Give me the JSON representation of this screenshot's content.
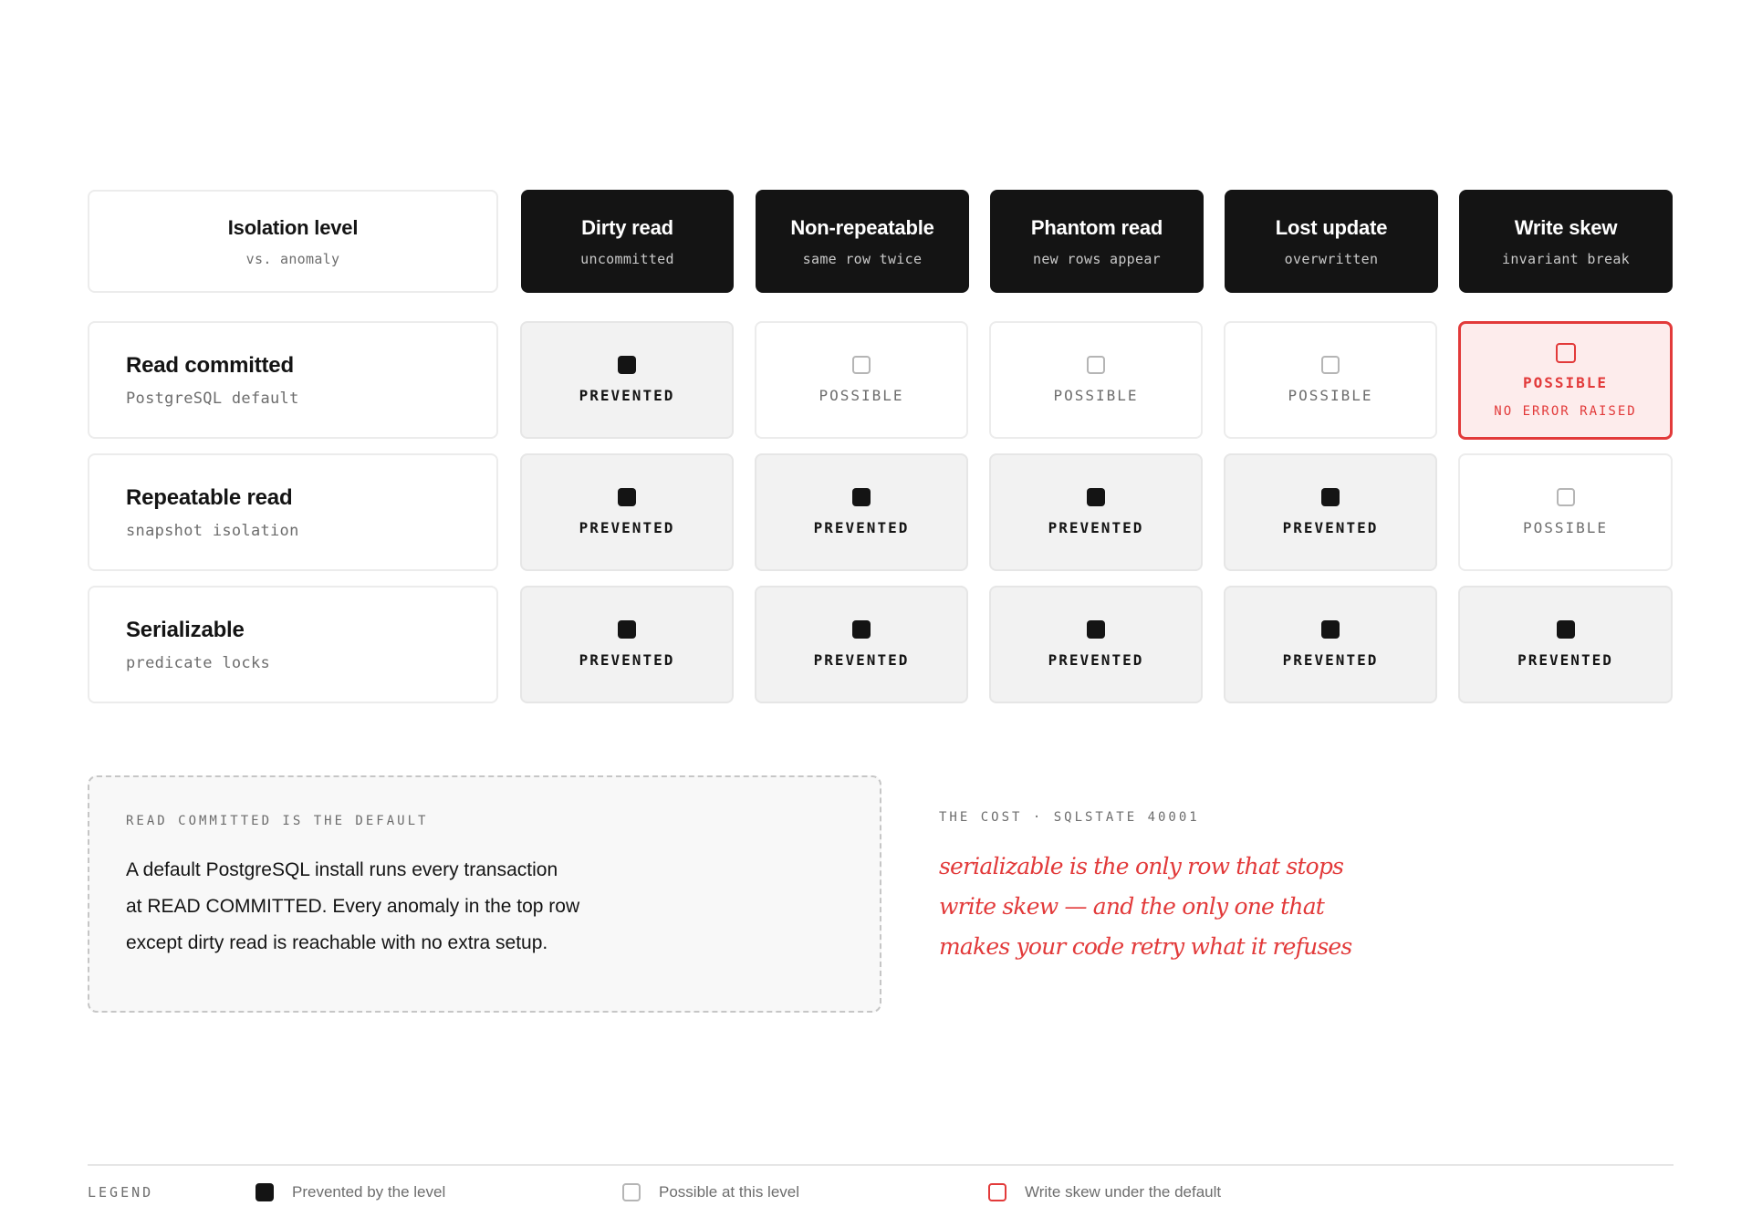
{
  "corner": {
    "title": "Isolation level",
    "subtitle": "vs. anomaly"
  },
  "columns": [
    {
      "title": "Dirty read",
      "subtitle": "uncommitted"
    },
    {
      "title": "Non-repeatable",
      "subtitle": "same row twice"
    },
    {
      "title": "Phantom read",
      "subtitle": "new rows appear"
    },
    {
      "title": "Lost update",
      "subtitle": "overwritten"
    },
    {
      "title": "Write skew",
      "subtitle": "invariant break"
    }
  ],
  "rows": [
    {
      "title": "Read committed",
      "subtitle": "PostgreSQL default",
      "cells": [
        {
          "status": "prevented",
          "label": "PREVENTED",
          "icon": "filled-square-icon"
        },
        {
          "status": "possible",
          "label": "POSSIBLE",
          "icon": "empty-square-icon"
        },
        {
          "status": "possible",
          "label": "POSSIBLE",
          "icon": "empty-square-icon"
        },
        {
          "status": "possible",
          "label": "POSSIBLE",
          "icon": "empty-square-icon"
        },
        {
          "status": "alert",
          "label": "POSSIBLE",
          "note": "NO ERROR RAISED",
          "icon": "red-square-icon"
        }
      ]
    },
    {
      "title": "Repeatable read",
      "subtitle": "snapshot isolation",
      "cells": [
        {
          "status": "prevented",
          "label": "PREVENTED",
          "icon": "filled-square-icon"
        },
        {
          "status": "prevented",
          "label": "PREVENTED",
          "icon": "filled-square-icon"
        },
        {
          "status": "prevented",
          "label": "PREVENTED",
          "icon": "filled-square-icon"
        },
        {
          "status": "prevented",
          "label": "PREVENTED",
          "icon": "filled-square-icon"
        },
        {
          "status": "possible",
          "label": "POSSIBLE",
          "icon": "empty-square-icon"
        }
      ]
    },
    {
      "title": "Serializable",
      "subtitle": "predicate locks",
      "cells": [
        {
          "status": "prevented",
          "label": "PREVENTED",
          "icon": "filled-square-icon"
        },
        {
          "status": "prevented",
          "label": "PREVENTED",
          "icon": "filled-square-icon"
        },
        {
          "status": "prevented",
          "label": "PREVENTED",
          "icon": "filled-square-icon"
        },
        {
          "status": "prevented",
          "label": "PREVENTED",
          "icon": "filled-square-icon"
        },
        {
          "status": "prevented",
          "label": "PREVENTED",
          "icon": "filled-square-icon"
        }
      ]
    }
  ],
  "note": {
    "eyebrow": "READ COMMITTED IS THE DEFAULT",
    "lines": [
      "A default PostgreSQL install runs every transaction",
      "at READ COMMITTED. Every anomaly in the top row",
      "except dirty read is reachable with no extra setup."
    ]
  },
  "cost": {
    "eyebrow": "THE COST · SQLSTATE 40001",
    "lines": [
      "serializable is the only row that stops",
      "write skew — and the only one that",
      "makes your code retry what it refuses"
    ]
  },
  "legend": {
    "title": "LEGEND",
    "items": [
      {
        "label": "Prevented by the level",
        "icon": "filled-square-icon"
      },
      {
        "label": "Possible at this level",
        "icon": "empty-square-icon"
      },
      {
        "label": "Write skew under the default",
        "icon": "red-square-icon"
      }
    ]
  },
  "colors": {
    "ink": "#141414",
    "accent_red": "#e23a3a",
    "alert_fill": "#fdecec",
    "prevented_fill": "#f2f2f2",
    "muted_text": "#6d6d6d"
  }
}
